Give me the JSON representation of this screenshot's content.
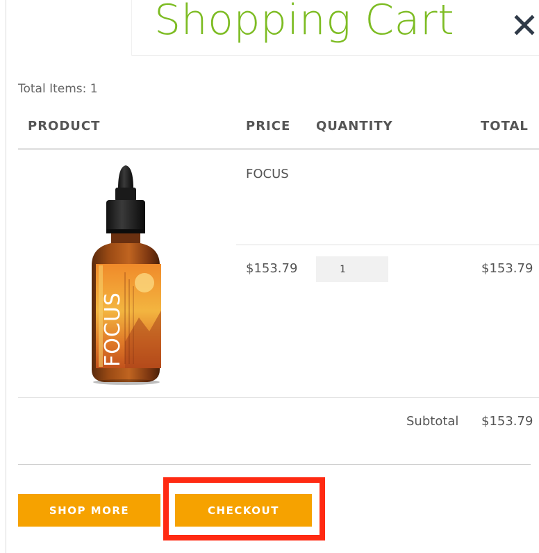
{
  "modal": {
    "title": "Shopping Cart",
    "close_icon": "close-icon"
  },
  "cart": {
    "total_items_text": "Total Items: 1",
    "columns": [
      "PRODUCT",
      "PRICE",
      "QUANTITY",
      "TOTAL"
    ],
    "items": [
      {
        "name": "FOCUS",
        "image_label": "FOCUS",
        "price": "$153.79",
        "quantity": "1",
        "total": "$153.79"
      }
    ],
    "subtotal_label": "Subtotal",
    "subtotal_value": "$153.79"
  },
  "actions": {
    "shop_more_label": "SHOP MORE",
    "checkout_label": "CHECKOUT"
  },
  "colors": {
    "title_green": "#7dbc23",
    "button_orange": "#f6a200",
    "highlight_red": "#ff2a12"
  }
}
